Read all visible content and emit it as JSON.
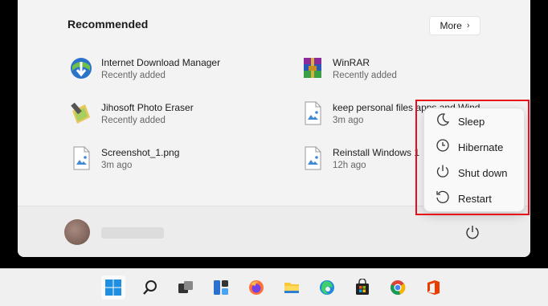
{
  "recommended": {
    "title": "Recommended",
    "more_label": "More",
    "items": [
      {
        "name": "Internet Download Manager",
        "sub": "Recently added",
        "icon": "idm-icon"
      },
      {
        "name": "WinRAR",
        "sub": "Recently added",
        "icon": "winrar-icon"
      },
      {
        "name": "Jihosoft Photo Eraser",
        "sub": "Recently added",
        "icon": "photo-eraser-icon"
      },
      {
        "name": "keep personal files apps and Wind",
        "sub": "3m ago",
        "icon": "image-file-icon"
      },
      {
        "name": "Screenshot_1.png",
        "sub": "3m ago",
        "icon": "image-file-icon"
      },
      {
        "name": "Reinstall Windows 1",
        "sub": "12h ago",
        "icon": "image-file-icon"
      }
    ]
  },
  "power_menu": {
    "items": [
      {
        "label": "Sleep",
        "icon": "sleep-icon"
      },
      {
        "label": "Hibernate",
        "icon": "clock-icon"
      },
      {
        "label": "Shut down",
        "icon": "power-icon"
      },
      {
        "label": "Restart",
        "icon": "restart-icon"
      }
    ]
  },
  "taskbar": {
    "items": [
      "start-icon",
      "search-icon",
      "task-view-icon",
      "widgets-icon",
      "firefox-icon",
      "file-explorer-icon",
      "edge-icon",
      "store-icon",
      "chrome-icon",
      "office-icon"
    ]
  },
  "colors": {
    "highlight": "#e8101a",
    "windows_blue": "#0078d4"
  }
}
